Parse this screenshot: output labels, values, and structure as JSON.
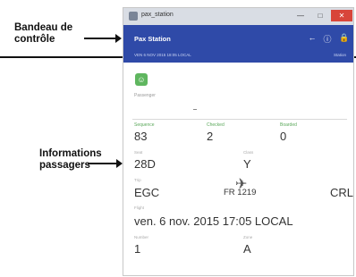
{
  "annotations": {
    "control_banner": "Bandeau de\ncontrôle",
    "passenger_info": "Informations\npassagers"
  },
  "window": {
    "title": "pax_station",
    "minimize_glyph": "—",
    "maximize_glyph": "□",
    "close_glyph": "✕"
  },
  "appbar": {
    "title": "Pax Station",
    "back_glyph": "←",
    "info_glyph": "ⓘ",
    "lock_glyph": "🔒",
    "status_text": "VEN 6 NOV 2015 18:05 LOCAL",
    "status_right": "Station"
  },
  "passenger": {
    "icon_glyph": "☺",
    "label": "Passenger"
  },
  "counts": {
    "sequence_label": "Sequence",
    "sequence_value": "83",
    "checked_label": "Checked",
    "checked_value": "2",
    "boarded_label": "Boarded",
    "boarded_value": "0"
  },
  "details": {
    "seat_label": "Seat",
    "seat_value": "28D",
    "class_label": "Class",
    "class_value": "Y",
    "trip_label": "Trip",
    "origin": "EGC",
    "flight": "FR 1219",
    "destination": "CRL",
    "plane_glyph": "✈",
    "datetime_label": "Flight",
    "datetime_value": "ven. 6 nov. 2015 17:05 LOCAL",
    "number_label": "Number",
    "number_value": "1",
    "zone_label": "Zone",
    "zone_value": "A"
  }
}
